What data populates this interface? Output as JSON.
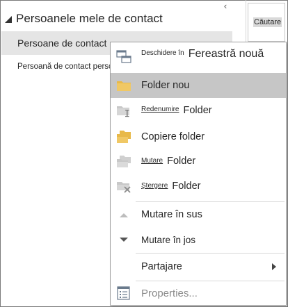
{
  "nav": {
    "header_title": "Persoanele mele de contact",
    "collapse_glyph": "‹",
    "items": [
      {
        "label": "Persoane de contact"
      },
      {
        "label": "Persoană de contact personală"
      }
    ]
  },
  "search": {
    "label": "Căutare"
  },
  "menu": {
    "open": {
      "small": "Deschidere în",
      "label": "Fereastră nouă"
    },
    "new_folder": {
      "label": "Folder nou"
    },
    "rename": {
      "small": "Redenumire",
      "label": "Folder"
    },
    "copy": {
      "label": "Copiere folder"
    },
    "move": {
      "small": "Mutare",
      "label": "Folder"
    },
    "delete": {
      "small": "Ștergere",
      "label": "Folder"
    },
    "move_up": {
      "label": "Mutare în sus"
    },
    "move_down": {
      "label": "Mutare în jos"
    },
    "share": {
      "label": "Partajare"
    },
    "properties": {
      "label": "Properties..."
    }
  },
  "colors": {
    "highlight": "#c6c6c6",
    "selected_nav": "#e5e5e5",
    "folder_yellow": "#e8b949",
    "disabled_grey": "#c2c2c2"
  }
}
